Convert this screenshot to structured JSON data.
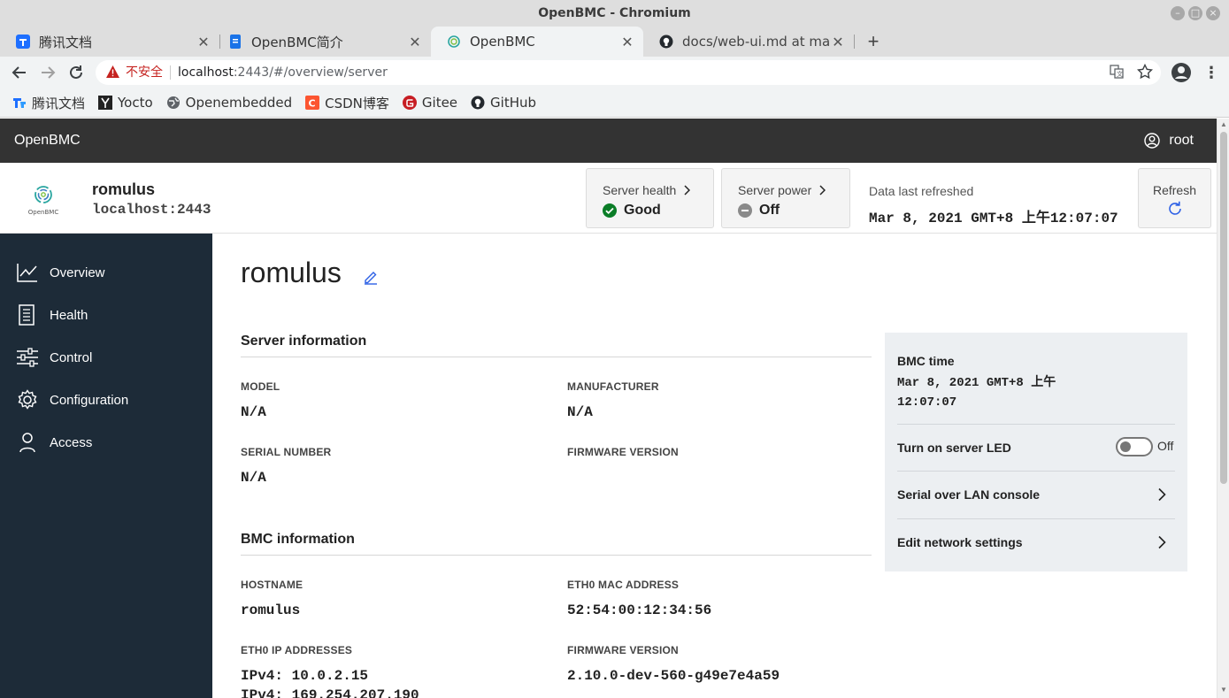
{
  "browser": {
    "window_title": "OpenBMC - Chromium",
    "tabs": [
      {
        "label": "腾讯文档",
        "active": false
      },
      {
        "label": "OpenBMC简介",
        "active": false
      },
      {
        "label": "OpenBMC",
        "active": true
      },
      {
        "label": "docs/web-ui.md at master",
        "active": false
      }
    ],
    "security_label": "不安全",
    "url_host": "localhost",
    "url_rest": ":2443/#/overview/server",
    "bookmarks": [
      {
        "label": "腾讯文档",
        "icon": "tencent-docs-icon"
      },
      {
        "label": "Yocto",
        "icon": "yocto-icon"
      },
      {
        "label": "Openembedded",
        "icon": "globe-icon"
      },
      {
        "label": "CSDN博客",
        "icon": "csdn-icon"
      },
      {
        "label": "Gitee",
        "icon": "gitee-icon"
      },
      {
        "label": "GitHub",
        "icon": "github-icon"
      }
    ]
  },
  "app": {
    "brand": "OpenBMC",
    "user": "root",
    "logo_text": "OpenBMC",
    "colors": {
      "header": "#333333",
      "sidebar": "#1d2b38",
      "success": "#0a7d27",
      "link": "#2d60e5",
      "quick_panel": "#eceff2"
    }
  },
  "status": {
    "host_name": "romulus",
    "host_address": "localhost:2443",
    "server_health_label": "Server health",
    "server_health_value": "Good",
    "server_power_label": "Server power",
    "server_power_value": "Off",
    "refreshed_label": "Data last refreshed",
    "refreshed_value": "Mar 8, 2021 GMT+8 上午12:07:07",
    "refresh_label": "Refresh"
  },
  "sidebar": {
    "items": [
      {
        "label": "Overview",
        "icon": "chart-line-icon"
      },
      {
        "label": "Health",
        "icon": "report-icon"
      },
      {
        "label": "Control",
        "icon": "sliders-icon"
      },
      {
        "label": "Configuration",
        "icon": "gear-icon"
      },
      {
        "label": "Access",
        "icon": "user-icon"
      }
    ]
  },
  "main": {
    "title": "romulus",
    "server_info": {
      "title": "Server information",
      "model_label": "MODEL",
      "model_value": "N/A",
      "manufacturer_label": "MANUFACTURER",
      "manufacturer_value": "N/A",
      "serial_label": "SERIAL NUMBER",
      "serial_value": "N/A",
      "firmware_label": "FIRMWARE VERSION",
      "firmware_value": ""
    },
    "bmc_info": {
      "title": "BMC information",
      "hostname_label": "HOSTNAME",
      "hostname_value": "romulus",
      "mac_label": "ETH0 MAC ADDRESS",
      "mac_value": "52:54:00:12:34:56",
      "ip_label": "ETH0 IP ADDRESSES",
      "ip_values": [
        "IPv4: 10.0.2.15",
        "IPv4: 169.254.207.190"
      ],
      "firmware_label": "FIRMWARE VERSION",
      "firmware_value": "2.10.0-dev-560-g49e7e4a59"
    },
    "quick_panel": {
      "bmc_time_label": "BMC time",
      "bmc_time_line1": "Mar 8, 2021 GMT+8 上午",
      "bmc_time_line2": "12:07:07",
      "led_label": "Turn on server LED",
      "led_state": "Off",
      "led_on": false,
      "sol_label": "Serial over LAN console",
      "network_label": "Edit network settings"
    }
  }
}
